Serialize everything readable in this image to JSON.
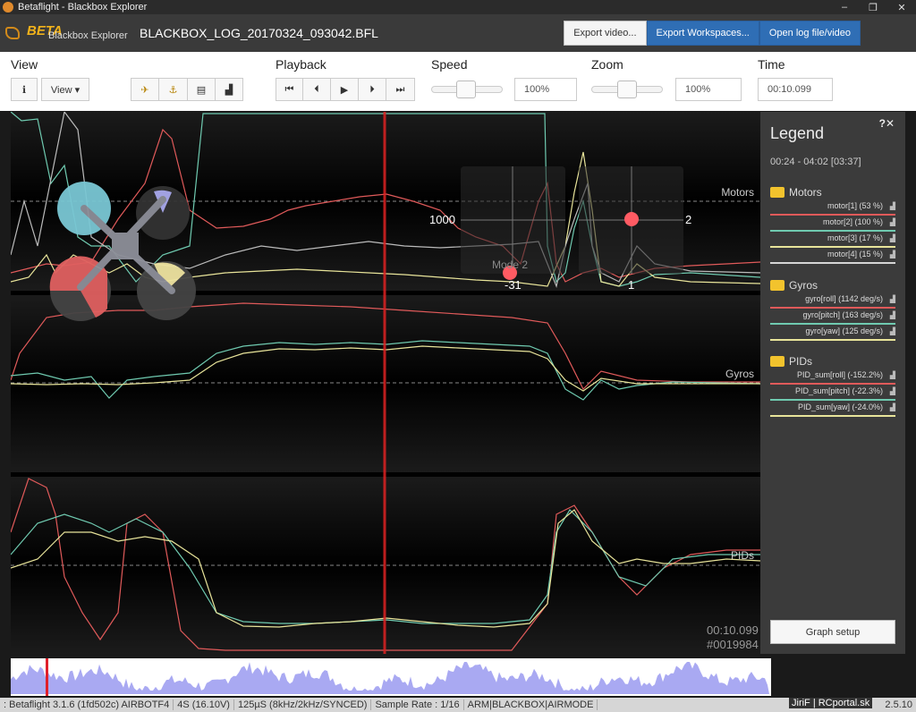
{
  "window": {
    "title": "Betaflight - Blackbox Explorer",
    "controls": [
      "–",
      "❐",
      "✕"
    ]
  },
  "header": {
    "logo_beta": "BETA",
    "logo_sub": "Blackbox Explorer",
    "log_name": "BLACKBOX_LOG_20170324_093042.BFL",
    "buttons": {
      "export_video": "Export video...",
      "export_workspaces": "Export Workspaces...",
      "open_log": "Open log file/video"
    }
  },
  "toolbar": {
    "view": {
      "label": "View",
      "info_icon": "ℹ",
      "view_menu": "View ▾"
    },
    "playback": {
      "label": "Playback"
    },
    "speed": {
      "label": "Speed",
      "value": "100%",
      "level": 0.5
    },
    "zoom": {
      "label": "Zoom",
      "value": "100%",
      "level": 0.5
    },
    "time": {
      "label": "Time",
      "value": "00:10.099"
    }
  },
  "graph": {
    "labels": {
      "motors": "Motors",
      "gyros": "Gyros",
      "pids": "PIDs"
    },
    "stick_left": {
      "value_left": "1000",
      "value_bottom": "-31",
      "mode": "Mode 2"
    },
    "stick_right": {
      "value_right": "2",
      "value_bottom": "1"
    },
    "time_readout": "00:10.099",
    "frame_readout": "#0019984"
  },
  "legend": {
    "title": "Legend",
    "help": "?✕",
    "range": "00:24 - 04:02 [03:37]",
    "groups": [
      {
        "name": "Motors",
        "items": [
          {
            "label": "motor[1] (53 %)",
            "color": "#e05a5a"
          },
          {
            "label": "motor[2] (100 %)",
            "color": "#6fcab0"
          },
          {
            "label": "motor[3] (17 %)",
            "color": "#e8e49a"
          },
          {
            "label": "motor[4] (15 %)",
            "color": "#d6d6d6"
          }
        ]
      },
      {
        "name": "Gyros",
        "items": [
          {
            "label": "gyro[roll] (1142 deg/s)",
            "color": "#e05a5a"
          },
          {
            "label": "gyro[pitch] (163 deg/s)",
            "color": "#6fcab0"
          },
          {
            "label": "gyro[yaw] (125 deg/s)",
            "color": "#e8e49a"
          }
        ]
      },
      {
        "name": "PIDs",
        "items": [
          {
            "label": "PID_sum[roll] (-152.2%)",
            "color": "#e05a5a"
          },
          {
            "label": "PID_sum[pitch] (-22.3%)",
            "color": "#6fcab0"
          },
          {
            "label": "PID_sum[yaw] (-24.0%)",
            "color": "#e8e49a"
          }
        ]
      }
    ],
    "graph_setup": "Graph setup"
  },
  "status": {
    "firmware": ": Betaflight 3.1.6 (1fd502c) AIRBOTF4",
    "battery": "4S (16.10V)",
    "loop": "125µS (8kHz/2kHz/SYNCED)",
    "sample_rate": "Sample Rate : 1/16",
    "flags": "ARM|BLACKBOX|AIRMODE",
    "credit": "JiriF | RCportal.sk",
    "version": "2.5.10"
  }
}
